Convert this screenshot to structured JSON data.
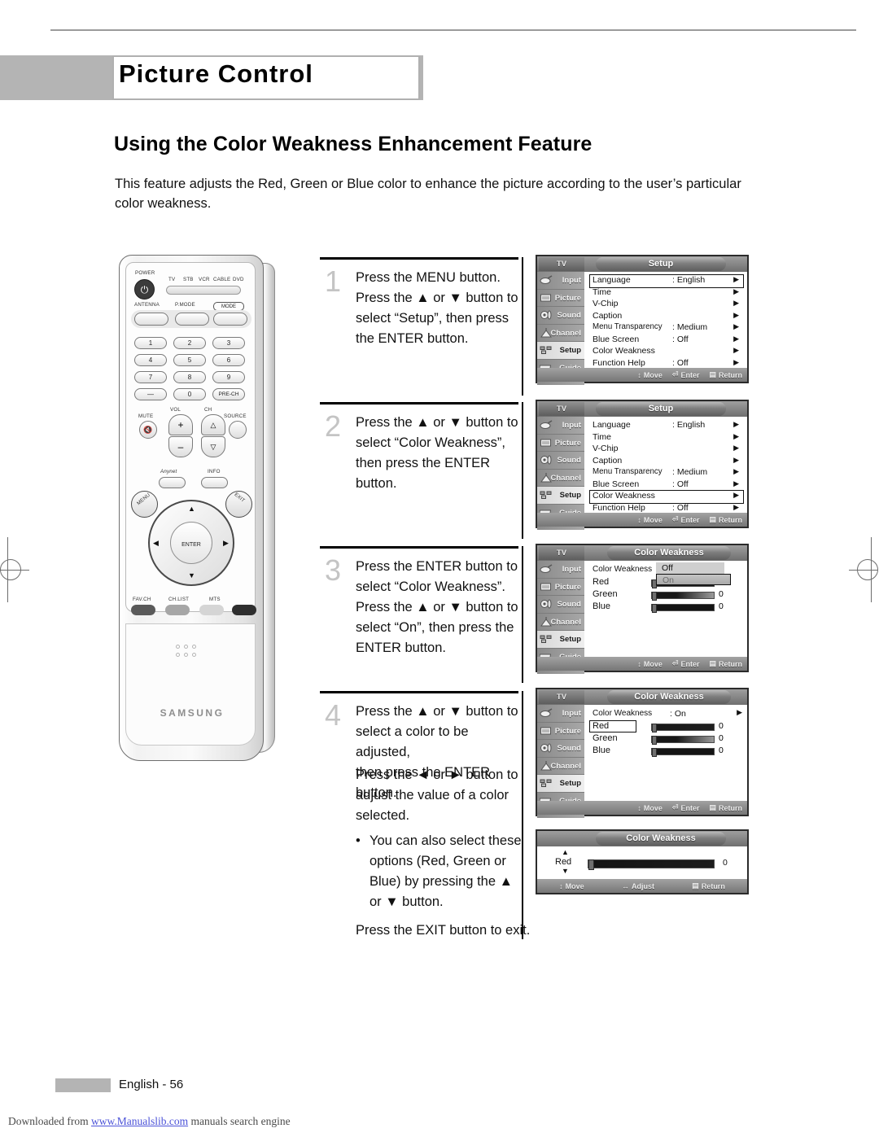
{
  "page": {
    "header_title": "Picture Control",
    "section_heading": "Using the Color Weakness Enhancement Feature",
    "intro": "This feature adjusts the Red, Green or Blue color to enhance the picture according to the user’s particular color weakness.",
    "footer_page": "English - 56",
    "download_prefix": "Downloaded from ",
    "download_link": "www.Manualslib.com",
    "download_suffix": " manuals search engine"
  },
  "remote": {
    "power_label": "POWER",
    "device_labels": [
      "TV",
      "STB",
      "VCR",
      "CABLE",
      "DVD"
    ],
    "antenna_label": "ANTENNA",
    "pmode_label": "P.MODE",
    "mode_label": "MODE",
    "numbers": [
      "1",
      "2",
      "3",
      "4",
      "5",
      "6",
      "7",
      "8",
      "9",
      "—",
      "0",
      "PRE-CH"
    ],
    "vol_label": "VOL",
    "ch_label": "CH",
    "mute_label": "MUTE",
    "source_label": "SOURCE",
    "anynet_label": "Anynet",
    "info_label": "INFO",
    "menu_label": "MENU",
    "exit_label": "EXIT",
    "enter_label": "ENTER",
    "bottom_buttons": [
      "FAV.CH",
      "CH.LIST",
      "MTS"
    ],
    "brand": "SAMSUNG"
  },
  "steps": [
    {
      "number": "1",
      "lines": [
        "Press the MENU button.",
        "Press the ▲ or ▼ button to",
        "select “Setup”, then press",
        "the ENTER button."
      ]
    },
    {
      "number": "2",
      "lines": [
        "Press the ▲ or ▼ button to",
        "select “Color Weakness”,",
        "then press the ENTER button."
      ]
    },
    {
      "number": "3",
      "lines": [
        "Press the ENTER button to",
        "select “Color Weakness”.",
        "Press the ▲ or ▼ button to",
        "select “On”, then press the",
        "ENTER button."
      ]
    },
    {
      "number": "4",
      "lines": [
        "Press the ▲ or ▼ button to",
        "select a color to be adjusted,",
        "then press the ENTER button."
      ]
    }
  ],
  "extra_text": {
    "adjust_lines": [
      "Press the ◄ or ► button to",
      "adjust the value of a color",
      "selected."
    ],
    "bullet_dot": "•",
    "bullet_lines": [
      "You can also select these",
      "options (Red, Green or",
      "Blue) by pressing the ▲",
      "or ▼ button."
    ],
    "exit_line": "Press the EXIT button to exit."
  },
  "osd_common": {
    "tv_tab": "TV",
    "sidebar": [
      {
        "label": "Input",
        "icon": "input-icon"
      },
      {
        "label": "Picture",
        "icon": "picture-icon"
      },
      {
        "label": "Sound",
        "icon": "sound-icon"
      },
      {
        "label": "Channel",
        "icon": "channel-icon"
      },
      {
        "label": "Setup",
        "icon": "setup-icon"
      },
      {
        "label": "Guide",
        "icon": "guide-icon"
      }
    ],
    "hints_move_enter_return": [
      {
        "glyph": "↕",
        "label": "Move"
      },
      {
        "glyph": "⏎",
        "label": "Enter"
      },
      {
        "glyph": "▤",
        "label": "Return"
      }
    ],
    "hints_move_adjust_return": [
      {
        "glyph": "↕",
        "label": "Move"
      },
      {
        "glyph": "↔",
        "label": "Adjust"
      },
      {
        "glyph": "▤",
        "label": "Return"
      }
    ]
  },
  "osd1": {
    "title": "Setup",
    "active_side": 4,
    "selected_row": 0,
    "rows": [
      {
        "label": "Language",
        "value": ": English",
        "arrow": "▶"
      },
      {
        "label": "Time",
        "value": "",
        "arrow": "▶"
      },
      {
        "label": "V-Chip",
        "value": "",
        "arrow": "▶"
      },
      {
        "label": "Caption",
        "value": "",
        "arrow": "▶"
      },
      {
        "label": "Menu Transparency",
        "value": ": Medium",
        "arrow": "▶"
      },
      {
        "label": "Blue Screen",
        "value": ": Off",
        "arrow": "▶"
      },
      {
        "label": "Color Weakness",
        "value": "",
        "arrow": "▶"
      },
      {
        "label": "Function Help",
        "value": ": Off",
        "arrow": "▶"
      }
    ]
  },
  "osd2": {
    "title": "Setup",
    "active_side": 4,
    "selected_row": 6,
    "rows": [
      {
        "label": "Language",
        "value": ": English",
        "arrow": "▶"
      },
      {
        "label": "Time",
        "value": "",
        "arrow": "▶"
      },
      {
        "label": "V-Chip",
        "value": "",
        "arrow": "▶"
      },
      {
        "label": "Caption",
        "value": "",
        "arrow": "▶"
      },
      {
        "label": "Menu Transparency",
        "value": ": Medium",
        "arrow": "▶"
      },
      {
        "label": "Blue Screen",
        "value": ": Off",
        "arrow": "▶"
      },
      {
        "label": "Color Weakness",
        "value": "",
        "arrow": "▶"
      },
      {
        "label": "Function Help",
        "value": ": Off",
        "arrow": "▶"
      }
    ]
  },
  "osd3": {
    "title": "Color Weakness",
    "active_side": 4,
    "rows": [
      {
        "label": "Color Weakness",
        "value": "",
        "arrow": ""
      },
      {
        "label": "Red",
        "value": "0",
        "arrow": ""
      },
      {
        "label": "Green",
        "value": "0",
        "arrow": ""
      },
      {
        "label": "Blue",
        "value": "0",
        "arrow": ""
      }
    ],
    "dropdown": {
      "options": [
        "Off",
        "On"
      ],
      "selected": "On"
    },
    "slider_values": {
      "red": 0,
      "green": 0,
      "blue": 0
    }
  },
  "osd4": {
    "title": "Color Weakness",
    "active_side": 4,
    "selected_row": 1,
    "rows": [
      {
        "label": "Color Weakness",
        "value": ": On",
        "arrow": "▶"
      },
      {
        "label": "Red",
        "value": "0",
        "arrow": ""
      },
      {
        "label": "Green",
        "value": "0",
        "arrow": ""
      },
      {
        "label": "Blue",
        "value": "0",
        "arrow": ""
      }
    ],
    "slider_values": {
      "red": 0,
      "green": 0,
      "blue": 0
    }
  },
  "osd5": {
    "title": "Color Weakness",
    "label": "Red",
    "value": "0",
    "up_arrow": "▲",
    "down_arrow": "▼"
  }
}
